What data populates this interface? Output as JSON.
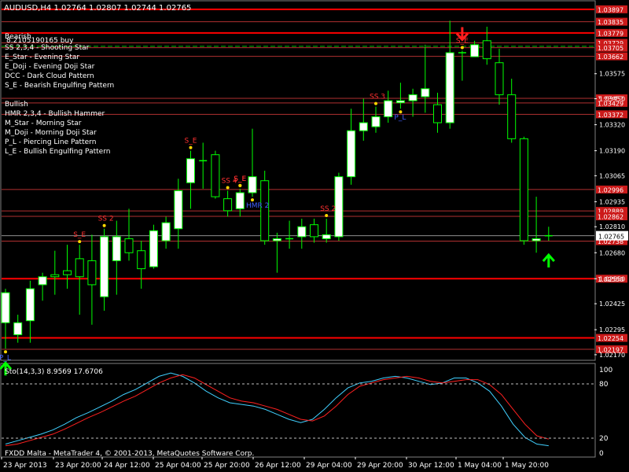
{
  "window": {
    "title": "AUDUSD,H4  1.02764 1.02807 1.02744 1.02765",
    "broker_footer": "FXDD Malta - MetaTrader 4, © 2001-2013, MetaQuotes Software Corp."
  },
  "colors": {
    "background": "#000000",
    "bull_candle": "#ffffff",
    "bear_candle": "#000000",
    "wick": "#00ff00",
    "level_line": "#ff0000",
    "level_line_dim": "#b03030",
    "dashed_green": "#00c000",
    "stoch_main": "#40d0ff",
    "stoch_signal": "#ff2020",
    "text": "#ffffff",
    "label_red": "#ff3030",
    "label_blue": "#4060ff",
    "label_yellow": "#ffd700",
    "arrow_green": "#00ff00",
    "arrow_red": "#ff2020",
    "current_price_box": "#ffffff"
  },
  "legend": {
    "bearish_header": "Bearish",
    "bearish_items": [
      "SS 2,3,4 - Shooting Star",
      "E_Star   - Evening Star",
      "E_Doji  - Evening Doji Star",
      "DCC      - Dark Cloud Pattern",
      "S_E      - Bearish Engulfing Pattern"
    ],
    "bullish_header": "Bullish",
    "bullish_items": [
      "HMR 2,3,4 - Bullish Hammer",
      "M_Star   - Morning Star",
      "M_Doji  - Morning Doji Star",
      "P_L       - Piercing Line Pattern",
      "L_E      - Bullish Engulfing Pattern"
    ],
    "overlay_text": "8.2105190165 buy"
  },
  "price_axis": {
    "ticks": [
      "1.03575",
      "1.03450",
      "1.03320",
      "1.03190",
      "1.03065",
      "1.02935",
      "1.02810",
      "1.02680",
      "1.02550",
      "1.02425",
      "1.02295",
      "1.02170"
    ],
    "level_labels": [
      "1.03897",
      "1.03835",
      "1.03779",
      "1.03729",
      "1.03705",
      "1.03662",
      "1.03452",
      "1.03429",
      "1.03372",
      "1.02996",
      "1.02889",
      "1.02862",
      "1.02738",
      "1.02550",
      "1.02254",
      "1.02197"
    ],
    "current_price": "1.02765"
  },
  "time_axis": {
    "labels": [
      "23 Apr 2013",
      "23 Apr 20:00",
      "24 Apr 12:00",
      "25 Apr 04:00",
      "25 Apr 20:00",
      "26 Apr 12:00",
      "29 Apr 04:00",
      "29 Apr 20:00",
      "30 Apr 12:00",
      "1 May 04:00",
      "1 May 20:00"
    ]
  },
  "stochastic": {
    "title": "Sto(14,3,3) 8.9569 17.6706",
    "axis_labels": [
      "100",
      "80",
      "20",
      "0"
    ],
    "main": [
      10,
      14,
      18,
      22,
      27,
      34,
      42,
      48,
      55,
      62,
      70,
      76,
      84,
      92,
      96,
      92,
      84,
      74,
      66,
      60,
      58,
      56,
      52,
      46,
      40,
      36,
      40,
      52,
      66,
      78,
      84,
      86,
      90,
      92,
      90,
      86,
      82,
      84,
      90,
      90,
      84,
      74,
      56,
      34,
      18,
      10,
      8
    ],
    "signal": [
      8,
      10,
      14,
      18,
      22,
      28,
      35,
      42,
      48,
      55,
      62,
      68,
      76,
      84,
      90,
      94,
      90,
      82,
      74,
      66,
      62,
      60,
      56,
      52,
      46,
      40,
      38,
      44,
      56,
      70,
      80,
      84,
      88,
      90,
      92,
      90,
      86,
      84,
      86,
      88,
      88,
      82,
      70,
      52,
      34,
      20,
      16
    ]
  },
  "pattern_labels": [
    {
      "text": "S_E",
      "color": "red"
    },
    {
      "text": "SS 2",
      "color": "red"
    },
    {
      "text": "S_E",
      "color": "red"
    },
    {
      "text": "S_E",
      "color": "red"
    },
    {
      "text": "SS 4",
      "color": "red"
    },
    {
      "text": "S_E",
      "color": "red"
    },
    {
      "text": "SS 2",
      "color": "red"
    },
    {
      "text": "SS 3",
      "color": "red"
    },
    {
      "text": "S_E",
      "color": "red"
    },
    {
      "text": "P_L",
      "color": "blue"
    },
    {
      "text": "HMR 2",
      "color": "blue"
    },
    {
      "text": "P_L",
      "color": "blue"
    }
  ],
  "chart_data": {
    "type": "candlestick",
    "symbol": "AUDUSD",
    "timeframe": "H4",
    "ylim": [
      1.0215,
      1.0392
    ],
    "candles": [
      {
        "o": 1.0233,
        "h": 1.025,
        "l": 1.022,
        "c": 1.0248
      },
      {
        "o": 1.0227,
        "h": 1.0237,
        "l": 1.0223,
        "c": 1.0233
      },
      {
        "o": 1.0234,
        "h": 1.0254,
        "l": 1.0223,
        "c": 1.025
      },
      {
        "o": 1.0252,
        "h": 1.0258,
        "l": 1.0244,
        "c": 1.0256
      },
      {
        "o": 1.0257,
        "h": 1.0269,
        "l": 1.0247,
        "c": 1.0256
      },
      {
        "o": 1.0259,
        "h": 1.0272,
        "l": 1.025,
        "c": 1.0257
      },
      {
        "o": 1.0265,
        "h": 1.0272,
        "l": 1.0237,
        "c": 1.0256
      },
      {
        "o": 1.0264,
        "h": 1.0277,
        "l": 1.0232,
        "c": 1.0252
      },
      {
        "o": 1.0246,
        "h": 1.028,
        "l": 1.0239,
        "c": 1.0276
      },
      {
        "o": 1.0264,
        "h": 1.0284,
        "l": 1.0247,
        "c": 1.0276
      },
      {
        "o": 1.0275,
        "h": 1.029,
        "l": 1.0264,
        "c": 1.0268
      },
      {
        "o": 1.0269,
        "h": 1.0274,
        "l": 1.025,
        "c": 1.026
      },
      {
        "o": 1.0261,
        "h": 1.0282,
        "l": 1.026,
        "c": 1.0279
      },
      {
        "o": 1.0274,
        "h": 1.0286,
        "l": 1.027,
        "c": 1.0283
      },
      {
        "o": 1.028,
        "h": 1.0305,
        "l": 1.027,
        "c": 1.0299
      },
      {
        "o": 1.0303,
        "h": 1.0319,
        "l": 1.029,
        "c": 1.0315
      },
      {
        "o": 1.0314,
        "h": 1.0323,
        "l": 1.03,
        "c": 1.0314
      },
      {
        "o": 1.0317,
        "h": 1.0319,
        "l": 1.0295,
        "c": 1.0296
      },
      {
        "o": 1.0295,
        "h": 1.0299,
        "l": 1.0286,
        "c": 1.0289
      },
      {
        "o": 1.029,
        "h": 1.03,
        "l": 1.0286,
        "c": 1.0298
      },
      {
        "o": 1.0298,
        "h": 1.033,
        "l": 1.0296,
        "c": 1.0306
      },
      {
        "o": 1.0304,
        "h": 1.0309,
        "l": 1.0272,
        "c": 1.0274
      },
      {
        "o": 1.0274,
        "h": 1.0278,
        "l": 1.0258,
        "c": 1.0275
      },
      {
        "o": 1.0275,
        "h": 1.0284,
        "l": 1.027,
        "c": 1.0275
      },
      {
        "o": 1.0276,
        "h": 1.0285,
        "l": 1.027,
        "c": 1.0281
      },
      {
        "o": 1.0282,
        "h": 1.0285,
        "l": 1.0273,
        "c": 1.0276
      },
      {
        "o": 1.0275,
        "h": 1.0285,
        "l": 1.0273,
        "c": 1.0277
      },
      {
        "o": 1.0276,
        "h": 1.0308,
        "l": 1.0274,
        "c": 1.0306
      },
      {
        "o": 1.0306,
        "h": 1.034,
        "l": 1.0302,
        "c": 1.0329
      },
      {
        "o": 1.0329,
        "h": 1.0345,
        "l": 1.0324,
        "c": 1.0333
      },
      {
        "o": 1.0331,
        "h": 1.0341,
        "l": 1.0328,
        "c": 1.0336
      },
      {
        "o": 1.0336,
        "h": 1.0349,
        "l": 1.0333,
        "c": 1.0344
      },
      {
        "o": 1.0343,
        "h": 1.0353,
        "l": 1.034,
        "c": 1.0344
      },
      {
        "o": 1.0344,
        "h": 1.035,
        "l": 1.0336,
        "c": 1.0347
      },
      {
        "o": 1.0346,
        "h": 1.0372,
        "l": 1.0338,
        "c": 1.035
      },
      {
        "o": 1.0342,
        "h": 1.0348,
        "l": 1.0328,
        "c": 1.0333
      },
      {
        "o": 1.0333,
        "h": 1.0384,
        "l": 1.033,
        "c": 1.0368
      },
      {
        "o": 1.0368,
        "h": 1.0369,
        "l": 1.0354,
        "c": 1.0368
      },
      {
        "o": 1.0366,
        "h": 1.0374,
        "l": 1.0366,
        "c": 1.0372
      },
      {
        "o": 1.0374,
        "h": 1.0381,
        "l": 1.0362,
        "c": 1.0365
      },
      {
        "o": 1.0363,
        "h": 1.037,
        "l": 1.0342,
        "c": 1.0347
      },
      {
        "o": 1.0347,
        "h": 1.0355,
        "l": 1.0323,
        "c": 1.0325
      },
      {
        "o": 1.0325,
        "h": 1.0326,
        "l": 1.0272,
        "c": 1.0274
      },
      {
        "o": 1.0274,
        "h": 1.0296,
        "l": 1.0268,
        "c": 1.0275
      },
      {
        "o": 1.0276,
        "h": 1.0281,
        "l": 1.0274,
        "c": 1.02765
      }
    ],
    "levels": [
      1.03897,
      1.03835,
      1.03779,
      1.03729,
      1.03705,
      1.03662,
      1.03452,
      1.03429,
      1.03372,
      1.02996,
      1.02889,
      1.02862,
      1.02738,
      1.0255,
      1.02254,
      1.02197
    ],
    "current_price": 1.02765,
    "signals": [
      {
        "type": "buy",
        "candle": 0
      },
      {
        "type": "sell",
        "candle": 37
      },
      {
        "type": "buy",
        "candle": 44
      }
    ]
  }
}
